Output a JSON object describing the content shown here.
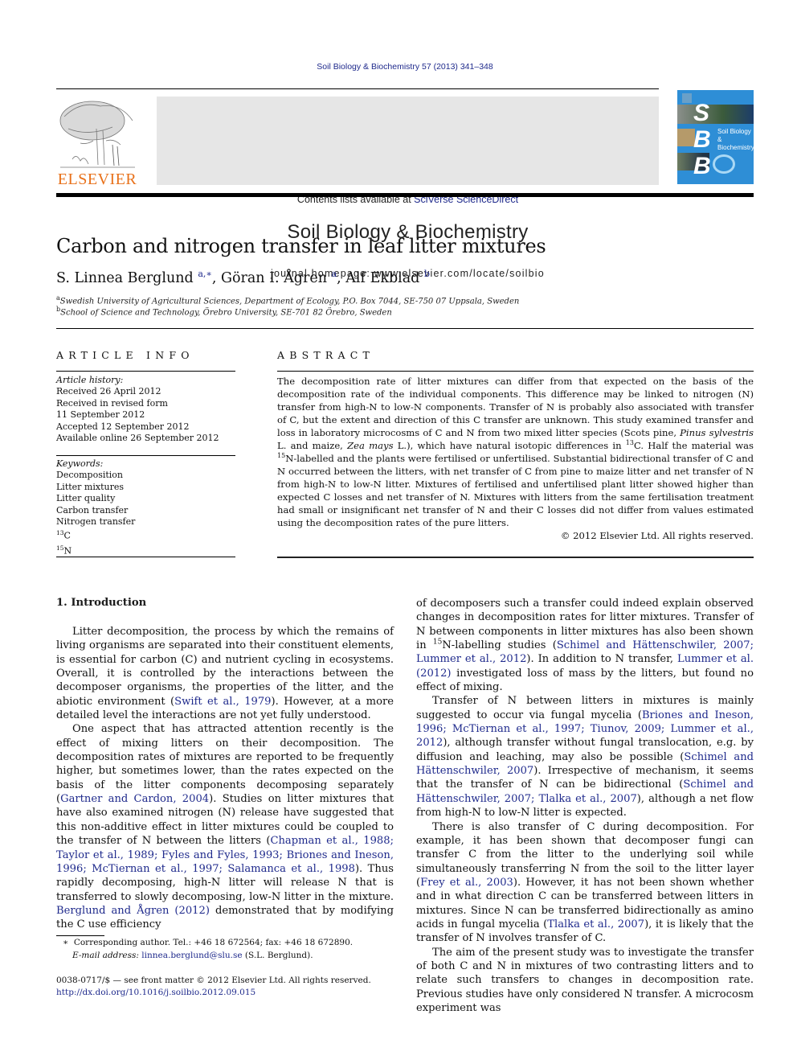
{
  "header": {
    "citation": "Soil Biology & Biochemistry 57 (2013) 341–348",
    "contents_prefix": "Contents lists available at ",
    "contents_link": "SciVerse ScienceDirect",
    "journal_title": "Soil Biology & Biochemistry",
    "homepage": "journal homepage: www.elsevier.com/locate/soilbio",
    "publisher_logo_text": "ELSEVIER",
    "cover_letters": [
      "S",
      "B",
      "B"
    ],
    "cover_title_line1": "Soil Biology &",
    "cover_title_line2": "Biochemistry",
    "colors": {
      "link": "#1f2a8c",
      "elsevier_orange": "#e8711a",
      "banner_bg": "#e6e6e6",
      "cover_blue": "#2e8ed6"
    }
  },
  "article": {
    "title": "Carbon and nitrogen transfer in leaf litter mixtures",
    "authors": [
      {
        "name": "S. Linnea Berglund",
        "sup": "a,∗",
        "sep": ", "
      },
      {
        "name": "Göran I. Ågren",
        "sup": "a",
        "sep": ", "
      },
      {
        "name": "Alf Ekblad",
        "sup": "b",
        "sep": ""
      }
    ],
    "affiliations": [
      {
        "mark": "a",
        "text": "Swedish University of Agricultural Sciences, Department of Ecology, P.O. Box 7044, SE-750 07 Uppsala, Sweden"
      },
      {
        "mark": "b",
        "text": "School of Science and Technology, Örebro University, SE-701 82 Örebro, Sweden"
      }
    ]
  },
  "article_info": {
    "heading": "ARTICLE INFO",
    "history_label": "Article history:",
    "history": [
      "Received 26 April 2012",
      "Received in revised form",
      "11 September 2012",
      "Accepted 12 September 2012",
      "Available online 26 September 2012"
    ],
    "keywords_label": "Keywords:",
    "keywords": [
      "Decomposition",
      "Litter mixtures",
      "Litter quality",
      "Carbon transfer",
      "Nitrogen transfer"
    ],
    "isotope_keywords": [
      {
        "sup": "13",
        "el": "C"
      },
      {
        "sup": "15",
        "el": "N"
      }
    ]
  },
  "abstract": {
    "heading": "ABSTRACT",
    "p1": "The decomposition rate of litter mixtures can differ from that expected on the basis of the decomposition rate of the individual components. This difference may be linked to nitrogen (N) transfer from high-N to low-N components. Transfer of N is probably also associated with transfer of C, but the extent and direction of this C transfer are unknown. This study examined transfer and loss in laboratory microcosms of C and N from two mixed litter species (Scots pine, ",
    "species1": "Pinus sylvestris",
    "p2": " L. and maize, ",
    "species2": "Zea mays",
    "p3": " L.), which have natural isotopic differences in ",
    "sup13": "13",
    "p4": "C. Half the material was ",
    "sup15": "15",
    "p5": "N-labelled and the plants were fertilised or unfertilised. Substantial bidirectional transfer of C and N occurred between the litters, with net transfer of C from pine to maize litter and net transfer of N from high-N to low-N litter. Mixtures of fertilised and unfertilised plant litter showed higher than expected C losses and net transfer of N. Mixtures with litters from the same fertilisation treatment had small or insignificant net transfer of N and their C losses did not differ from values estimated using the decomposition rates of the pure litters.",
    "copyright": "© 2012 Elsevier Ltd. All rights reserved."
  },
  "intro": {
    "heading": "1.  Introduction",
    "left": {
      "p1a": "Litter decomposition, the process by which the remains of living organisms are separated into their constituent elements, is essential for carbon (C) and nutrient cycling in ecosystems. Overall, it is controlled by the interactions between the decomposer organisms, the properties of the litter, and the abiotic environment (",
      "p1link": "Swift et al., 1979",
      "p1b": "). However, at a more detailed level the interactions are not yet fully understood.",
      "p2a": "One aspect that has attracted attention recently is the effect of mixing litters on their decomposition. The decomposition rates of mixtures are reported to be frequently higher, but sometimes lower, than the rates expected on the basis of the litter components decomposing separately (",
      "p2link1": "Gartner and Cardon, 2004",
      "p2b": "). Studies on litter mixtures that have also examined nitrogen (N) release have suggested that this non-additive effect in litter mixtures could be coupled to the transfer of N between the litters (",
      "p2link2": "Chapman et al., 1988; Taylor et al., 1989; Fyles and Fyles, 1993; Briones and Ineson, 1996; McTiernan et al., 1997; Salamanca et al., 1998",
      "p2c": "). Thus rapidly decomposing, high-N litter will release N that is transferred to slowly decomposing, low-N litter in the mixture. ",
      "p2link3": "Berglund and Ågren (2012)",
      "p2d": " demonstrated that by modifying the C use efficiency"
    },
    "right": {
      "p1a": "of decomposers such a transfer could indeed explain observed changes in decomposition rates for litter mixtures. Transfer of N between components in litter mixtures has also been shown in ",
      "p1sup": "15",
      "p1b": "N-labelling studies (",
      "p1link1": "Schimel and Hättenschwiler, 2007; Lummer et al., 2012",
      "p1c": "). In addition to N transfer, ",
      "p1link2": "Lummer et al. (2012)",
      "p1d": " investigated loss of mass by the litters, but found no effect of mixing.",
      "p2a": "Transfer of N between litters in mixtures is mainly suggested to occur via fungal mycelia (",
      "p2link1": "Briones and Ineson, 1996; McTiernan et al., 1997; Tiunov, 2009; Lummer et al., 2012",
      "p2b": "), although transfer without fungal translocation, e.g. by diffusion and leaching, may also be possible (",
      "p2link2": "Schimel and Hättenschwiler, 2007",
      "p2c": "). Irrespective of mechanism, it seems that the transfer of N can be bidirectional (",
      "p2link3": "Schimel and Hättenschwiler, 2007; Tlalka et al., 2007",
      "p2d": "), although a net flow from high-N to low-N litter is expected.",
      "p3a": "There is also transfer of C during decomposition. For example, it has been shown that decomposer fungi can transfer C from the litter to the underlying soil while simultaneously transferring N from the soil to the litter layer (",
      "p3link1": "Frey et al., 2003",
      "p3b": "). However, it has not been shown whether and in what direction C can be transferred between litters in mixtures. Since N can be transferred bidirectionally as amino acids in fungal mycelia (",
      "p3link2": "Tlalka et al., 2007",
      "p3c": "), it is likely that the transfer of N involves transfer of C.",
      "p4": "The aim of the present study was to investigate the transfer of both C and N in mixtures of two contrasting litters and to relate such transfers to changes in decomposition rate. Previous studies have only considered N transfer. A microcosm experiment was"
    }
  },
  "footnote": {
    "star": "∗",
    "text": "Corresponding author. Tel.: +46 18 672564; fax: +46 18 672890.",
    "email_label": "E-mail address: ",
    "email": "linnea.berglund@slu.se",
    "email_suffix": " (S.L. Berglund)."
  },
  "front_matter": {
    "issn_line": "0038-0717/$ — see front matter © 2012 Elsevier Ltd. All rights reserved.",
    "doi": "http://dx.doi.org/10.1016/j.soilbio.2012.09.015"
  }
}
